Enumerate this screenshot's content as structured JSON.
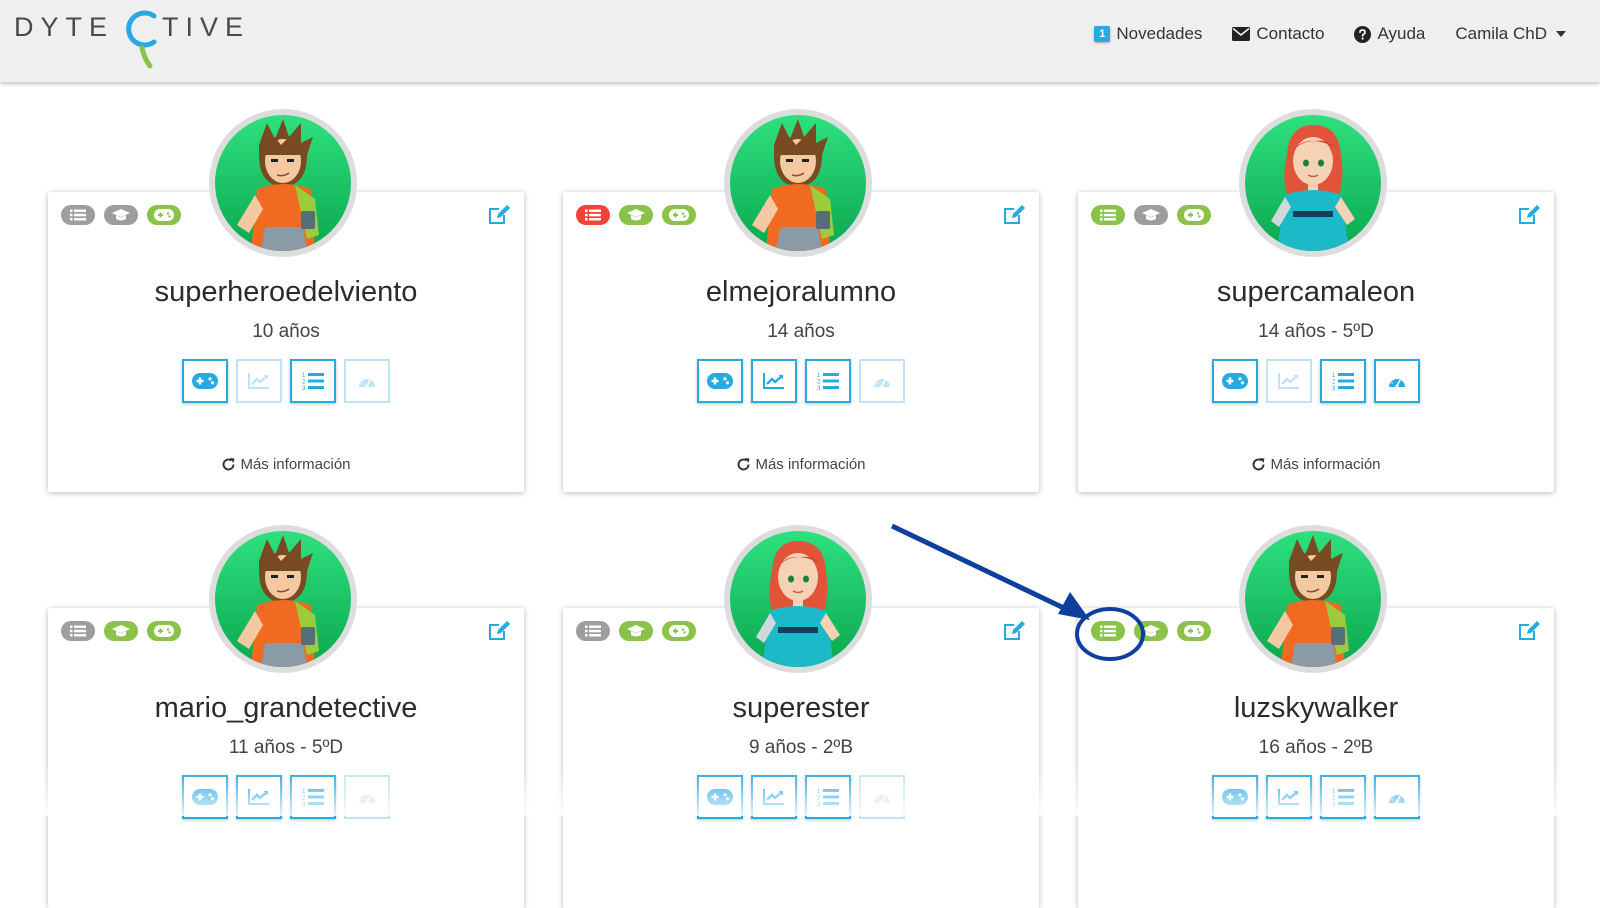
{
  "app": {
    "logo_left": "DYTE",
    "logo_right": "TIVE"
  },
  "nav": {
    "news_badge": "1",
    "news_label": "Novedades",
    "contact_label": "Contacto",
    "help_label": "Ayuda",
    "user_label": "Camila ChD"
  },
  "colors": {
    "accent": "#27a9e1",
    "green": "#8bc34a",
    "gray": "#9e9e9e",
    "red": "#f44336"
  },
  "more_info_label": "Más información",
  "students": [
    {
      "username": "superheroedelviento",
      "age": "10 años",
      "avatar": "boy",
      "status": [
        "gray",
        "gray",
        "green"
      ],
      "actions": [
        true,
        false,
        true,
        false
      ],
      "show_more": true
    },
    {
      "username": "elmejoralumno",
      "age": "14 años",
      "avatar": "boy",
      "status": [
        "red",
        "green",
        "green"
      ],
      "actions": [
        true,
        true,
        true,
        false
      ],
      "show_more": true
    },
    {
      "username": "supercamaleon",
      "age": "14 años - 5ºD",
      "avatar": "girl",
      "status": [
        "green",
        "gray",
        "green"
      ],
      "actions": [
        true,
        false,
        true,
        true
      ],
      "show_more": true
    },
    {
      "username": "mario_grandetective",
      "age": "11 años - 5ºD",
      "avatar": "boy",
      "status": [
        "gray",
        "green",
        "green"
      ],
      "actions": [
        true,
        true,
        true,
        false
      ],
      "show_more": false
    },
    {
      "username": "superester",
      "age": "9 años - 2ºB",
      "avatar": "girl",
      "status": [
        "gray",
        "green",
        "green"
      ],
      "actions": [
        true,
        true,
        true,
        false
      ],
      "show_more": false
    },
    {
      "username": "luzskywalker",
      "age": "16 años - 2ºB",
      "avatar": "boy",
      "status": [
        "green",
        "green",
        "green"
      ],
      "actions": [
        true,
        true,
        true,
        true
      ],
      "show_more": false
    }
  ],
  "icons": {
    "status": [
      "list-icon",
      "graduation-cap-icon",
      "gamepad-icon"
    ],
    "actions": [
      "gamepad-icon",
      "chart-icon",
      "ordered-list-icon",
      "dashboard-icon"
    ],
    "edit": "edit-icon",
    "refresh": "refresh-icon"
  },
  "annotation": {
    "type": "arrow-with-circle",
    "target": "luzskywalker status list pill"
  }
}
